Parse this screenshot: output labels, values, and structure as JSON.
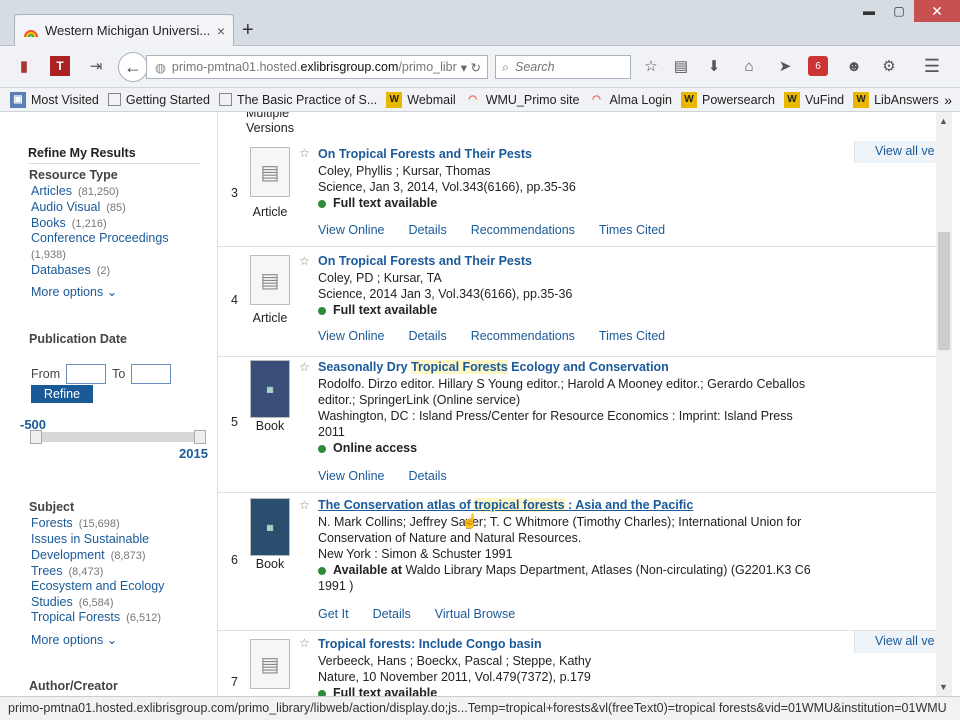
{
  "browser": {
    "tab_title": "Western Michigan Universi...",
    "tab_close": "×",
    "new_tab": "+",
    "url_prefix": "primo-pmtna01.hosted.",
    "url_domain": "exlibrisgroup.com",
    "url_suffix": "/primo_libr",
    "search_placeholder": "Search",
    "bookmarks": [
      "Most Visited",
      "Getting Started",
      "The Basic Practice of S...",
      "Webmail",
      "WMU_Primo site",
      "Alma Login",
      "Powersearch",
      "VuFind",
      "LibAnswers"
    ],
    "bookmark_more": "»",
    "notification_badge": "6",
    "status_url": "primo-pmtna01.hosted.exlibrisgroup.com/primo_library/libweb/action/display.do;js...Temp=tropical+forests&vl(freeText0)=tropical forests&vid=01WMU&institution=01WMU"
  },
  "sidebar": {
    "header_cut": "Multiple Versions",
    "title": "Refine My Results",
    "resource_type": {
      "label": "Resource Type",
      "items": [
        {
          "label": "Articles",
          "count": "(81,250)"
        },
        {
          "label": "Audio Visual",
          "count": "(85)"
        },
        {
          "label": "Books",
          "count": "(1,216)"
        },
        {
          "label": "Conference Proceedings",
          "count": "(1,938)"
        },
        {
          "label": "Databases",
          "count": "(2)"
        }
      ],
      "more": "More options ⌄"
    },
    "publication_date": {
      "label": "Publication Date",
      "from": "From",
      "to": "To",
      "refine": "Refine",
      "min": "-500",
      "max": "2015"
    },
    "subject": {
      "label": "Subject",
      "items": [
        {
          "label": "Forests",
          "count": "(15,698)"
        },
        {
          "label": "Issues in Sustainable Development",
          "count": "(8,873)"
        },
        {
          "label": "Trees",
          "count": "(8,473)"
        },
        {
          "label": "Ecosystem and Ecology Studies",
          "count": "(6,584)"
        },
        {
          "label": "Tropical Forests",
          "count": "(6,512)"
        }
      ],
      "more": "More options ⌄"
    },
    "author_label": "Author/Creator"
  },
  "results": [
    {
      "num": "3",
      "type": "Article",
      "title": "On Tropical Forests and Their Pests",
      "authors": "Coley, Phyllis ; Kursar, Thomas",
      "source": "Science, Jan 3, 2014, Vol.343(6166), pp.35-36",
      "availability": "Full text available",
      "links": [
        "View Online",
        "Details",
        "Recommendations",
        "Times Cited"
      ],
      "view_all": "View all ve"
    },
    {
      "num": "4",
      "type": "Article",
      "title": "On Tropical Forests and Their Pests",
      "authors": "Coley, PD ; Kursar, TA",
      "source": "Science, 2014 Jan 3, Vol.343(6166), pp.35-36",
      "availability": "Full text available",
      "links": [
        "View Online",
        "Details",
        "Recommendations",
        "Times Cited"
      ]
    },
    {
      "num": "5",
      "type": "Book",
      "title_a": "Seasonally Dry ",
      "title_hl": "Tropical Forests",
      "title_b": " Ecology and Conservation",
      "authors": "Rodolfo. Dirzo editor. Hillary S Young editor.; Harold A Mooney editor.; Gerardo Ceballos editor.; SpringerLink (Online service)",
      "source": "Washington, DC : Island Press/Center for Resource Economics : Imprint: Island Press 2011",
      "availability": "Online access",
      "links": [
        "View Online",
        "Details"
      ]
    },
    {
      "num": "6",
      "type": "Book",
      "title_a": "The Conservation atlas of ",
      "title_hl": "tropical forests",
      "title_b": " : Asia and the Pacific",
      "authors": "N. Mark Collins; Jeffrey Sayer; T. C Whitmore (Timothy Charles); International Union for Conservation of Nature and Natural Resources.",
      "source": "New York : Simon & Schuster 1991",
      "availability_label": "Available at",
      "availability": " Waldo Library Maps Department, Atlases (Non-circulating) (G2201.K3 C6 1991 )",
      "links": [
        "Get It",
        "Details",
        "Virtual Browse"
      ]
    },
    {
      "num": "7",
      "type": "Article",
      "title": "Tropical forests: Include Congo basin",
      "authors": "Verbeeck, Hans ; Boeckx, Pascal ; Steppe, Kathy",
      "source": "Nature, 10 November 2011, Vol.479(7372), p.179",
      "availability": "Full text available",
      "view_all": "View all ve"
    }
  ]
}
